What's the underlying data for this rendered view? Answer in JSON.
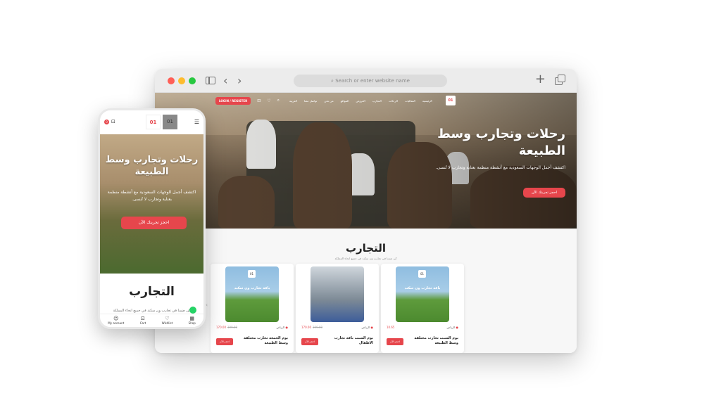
{
  "browser": {
    "url_placeholder": "Search or enter website name",
    "nav": {
      "login": "LOGIN / REGISTER",
      "links": [
        "العربية",
        "تواصل معنا",
        "من نحن",
        "المواقع",
        "العروض",
        "التجارب",
        "الرحلات",
        "الفعاليات",
        "الرئيسية"
      ],
      "logo": "01"
    },
    "hero": {
      "title": "رحلات وتجارب وسط الطبيعة",
      "subtitle": "اكتشف أجمل الوجهات السعودية مع أنشطة منظمة بعناية وتجارب لا تُنسى.",
      "cta": "احجز تجربتك الآن"
    },
    "section": {
      "title": "التجارب",
      "subtitle": "كن ضمنا في تجارب ون سكند في جميع انحاء المملكة"
    },
    "cards": [
      {
        "location": "الرياض",
        "price": "170.00",
        "old_price": "199.00",
        "name": "يوم الجمعة تجارب مختلفة وسط الطبيعة",
        "cta": "احجز الآن",
        "image_text": "باقة تجارب ون سكند"
      },
      {
        "location": "الرياض",
        "price": "170.00",
        "old_price": "199.00",
        "name": "يوم السبت باقة تجارب الاطفال",
        "cta": "احجز الآن",
        "image_text": ""
      },
      {
        "location": "الرياض",
        "price": "10.65",
        "old_price": "",
        "name": "يوم السبت تجارب مختلفة وسط الطبيعة",
        "cta": "احجز الآن",
        "image_text": "باقة تجارب ون سكند"
      }
    ]
  },
  "phone": {
    "logo": "01",
    "hero": {
      "title": "رحلات وتجارب وسط الطبيعة",
      "subtitle": "اكتشف أجمل الوجهات السعودية مع أنشطة منظمة بعناية وتجارب لا تُنسى.",
      "cta": "احجز تجربتك الآن"
    },
    "section": {
      "title": "التجارب",
      "subtitle": "كن ضمنا في تجارب ون سكند في جميع انحاء المملكة"
    },
    "cart_count": "0",
    "tabs": [
      {
        "label": "My account",
        "icon": "user-icon"
      },
      {
        "label": "Cart",
        "icon": "cart-icon"
      },
      {
        "label": "Wishlist",
        "icon": "heart-icon"
      },
      {
        "label": "Shop",
        "icon": "shop-icon"
      }
    ]
  },
  "colors": {
    "accent": "#e6464c",
    "whatsapp": "#25d366"
  }
}
